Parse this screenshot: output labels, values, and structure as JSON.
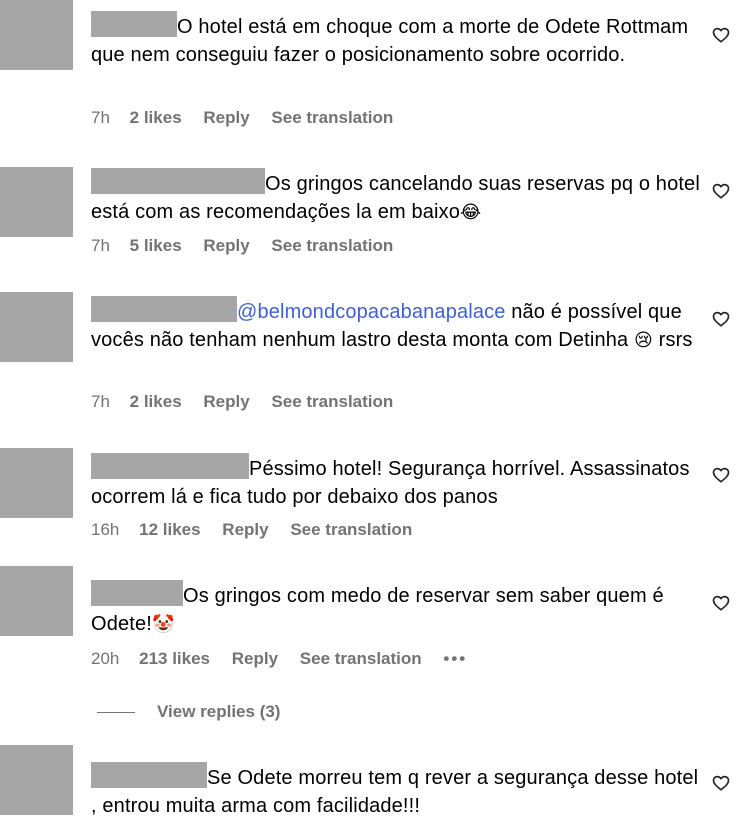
{
  "comments": [
    {
      "text_before_mention": "",
      "mention": "",
      "text": "O hotel está em choque com a morte de Odete Rottmam que nem conseguiu fazer o posicionamento sobre ocorrido.",
      "emoji": "",
      "time": "7h",
      "likes": "2 likes",
      "reply": "Reply",
      "translate": "See translation"
    },
    {
      "mention": "",
      "text": "Os gringos cancelando suas reservas pq o hotel está com as recomendações la em baixo",
      "emoji": "😂",
      "time": "7h",
      "likes": "5 likes",
      "reply": "Reply",
      "translate": "See translation"
    },
    {
      "mention": "@belmondcopacabanapalace",
      "text": " não é possível que vocês não tenham nenhum lastro desta monta com Detinha ",
      "emoji": "😢",
      "text_after_emoji": " rsrs",
      "time": "7h",
      "likes": "2 likes",
      "reply": "Reply",
      "translate": "See translation"
    },
    {
      "mention": "",
      "text": "Péssimo hotel! Segurança horrível. Assassinatos ocorrem lá e fica tudo por debaixo dos panos",
      "emoji": "",
      "time": "16h",
      "likes": "12 likes",
      "reply": "Reply",
      "translate": "See translation"
    },
    {
      "mention": "",
      "text": "Os gringos com medo de reservar sem saber quem é Odete!",
      "emoji": "🤡",
      "time": "20h",
      "likes": "213 likes",
      "reply": "Reply",
      "translate": "See translation",
      "more": "•••"
    },
    {
      "mention": "",
      "text": "Se Odete morreu tem q rever a segurança desse hotel , entrou muita arma com facilidade!!!",
      "emoji": ""
    }
  ],
  "view_replies": "View replies (3)",
  "icons": {
    "like": "heart-outline-icon",
    "more": "more-options-icon"
  },
  "colors": {
    "mention": "#3f5fd6",
    "meta": "#737373",
    "redacted": "#a6a6a6"
  }
}
